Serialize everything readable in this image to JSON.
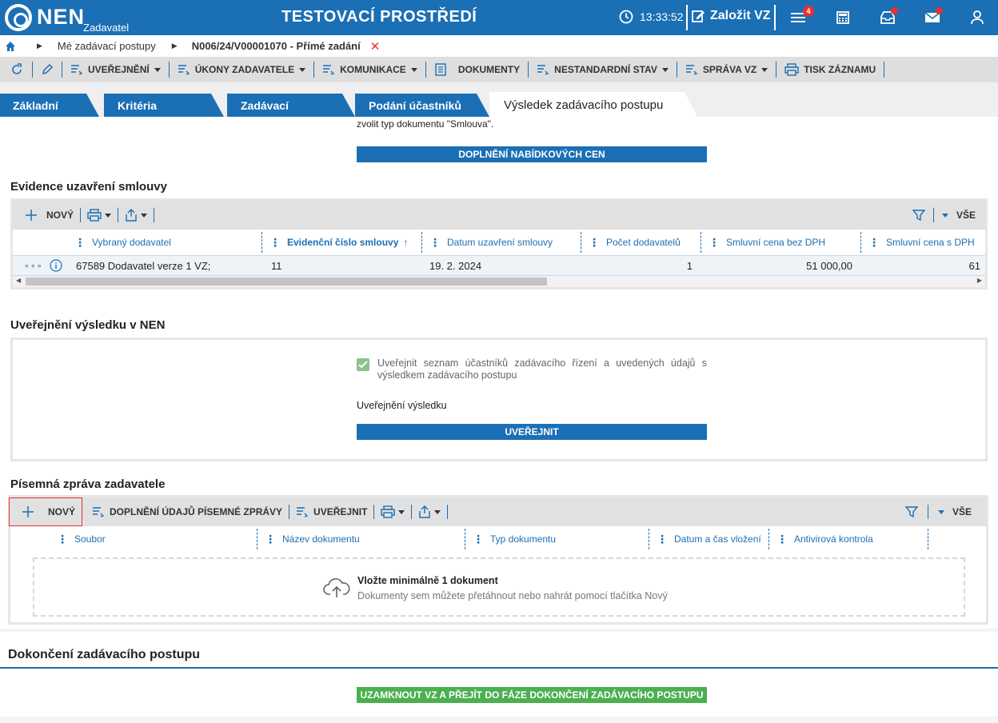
{
  "header": {
    "brand": "NEN",
    "brand_sub": "Zadavatel",
    "env_title": "TESTOVACÍ PROSTŘEDÍ",
    "time": "13:33:52",
    "create_label": "Založit VZ",
    "notif_count": "4"
  },
  "breadcrumb": {
    "item1": "Mé zadávací postupy",
    "item2": "N006/24/V00001070 - Přímé zadání"
  },
  "toolbar": {
    "uverejneni": "UVEŘEJNĚNÍ",
    "ukony": "ÚKONY ZADAVATELE",
    "komunikace": "KOMUNIKACE",
    "dokumenty": "DOKUMENTY",
    "nestandardni": "NESTANDARDNÍ STAV",
    "sprava": "SPRÁVA VZ",
    "tisk": "TISK ZÁZNAMU"
  },
  "tabs": [
    {
      "label": "Základní údaje"
    },
    {
      "label": "Kritéria hodnocení"
    },
    {
      "label": "Zadávací podmínky"
    },
    {
      "label": "Podání účastníků ZP"
    },
    {
      "label": "Výsledek zadávacího postupu"
    }
  ],
  "top_note": "zvolit typ dokumentu \"Smlouva\".",
  "doplneni_btn": "DOPLNĚNÍ NABÍDKOVÝCH CEN",
  "evidence": {
    "title": "Evidence uzavření smlouvy",
    "new_label": "NOVÝ",
    "all_label": "VŠE",
    "columns": [
      "Vybraný dodavatel",
      "Evidenční číslo smlouvy",
      "Datum uzavření smlouvy",
      "Počet dodavatelů",
      "Smluvní cena bez DPH",
      "Smluvní cena s DPH"
    ],
    "row": {
      "dodavatel": "67589 Dodavatel verze 1 VZ;",
      "cislo": "11",
      "datum": "19. 2. 2024",
      "pocet": "1",
      "cena_bez": "51 000,00",
      "cena_s": "61"
    }
  },
  "uverejneni": {
    "title": "Uveřejnění výsledku v NEN",
    "checkbox_label": "Uveřejnit seznam účastníků zadávacího řízení a uvedených údajů s výsledkem zadávacího postupu",
    "checked": true,
    "sub_label": "Uveřejnění výsledku",
    "button": "UVEŘEJNIT"
  },
  "pisemna": {
    "title": "Písemná zpráva zadavatele",
    "new_label": "NOVÝ",
    "doplneni_label": "DOPLNĚNÍ ÚDAJŮ PÍSEMNÉ ZPRÁVY",
    "uverejnit_label": "UVEŘEJNIT",
    "all_label": "VŠE",
    "columns": [
      "Soubor",
      "Název dokumentu",
      "Typ dokumentu",
      "Datum a čas vložení",
      "Antivirová kontrola"
    ],
    "drop_title": "Vložte minimálně 1 dokument",
    "drop_sub": "Dokumenty sem můžete přetáhnout nebo nahrát pomocí tlačítka Nový"
  },
  "dokonceni": {
    "title": "Dokončení zadávacího postupu",
    "button": "UZAMKNOUT VZ A PŘEJÍT DO FÁZE DOKONČENÍ ZADÁVACÍHO POSTUPU"
  },
  "colors": {
    "primary": "#1b6fb5",
    "green": "#4caf50",
    "danger": "#e5322b"
  }
}
